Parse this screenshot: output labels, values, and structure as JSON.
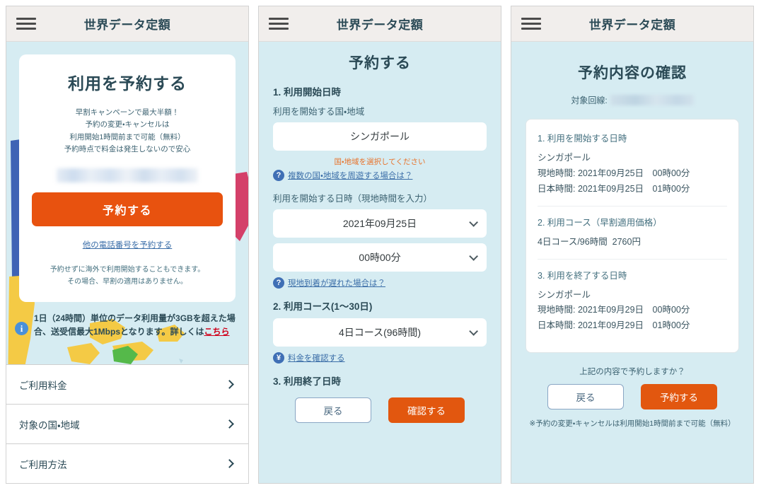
{
  "app": {
    "title": "世界データ定額",
    "menu_icon": "hamburger-icon",
    "colors": {
      "header_bg": "#f1eeec",
      "screen_bg": "#d6ecf2",
      "accent_orange": "#e8520f",
      "link_blue": "#3b6ea8",
      "title_navy": "#2b4a56",
      "error_orange": "#e8722a",
      "alert_red": "#d0021b"
    }
  },
  "screen1": {
    "hero": {
      "title": "利用を予約する",
      "subtitle_lines": [
        "早割キャンペーンで最大半額！",
        "予約の変更・キャンセルは",
        "利用開始1時間前まで可能（無料）",
        "予約時点で料金は発生しないので安心"
      ],
      "phone_number_masked": "",
      "reserve_button": "予約する",
      "other_number_link": "他の電話番号を予約する",
      "note_lines": [
        "予約せずに海外で利用開始することもできます。",
        "その場合、早割の適用はありません。"
      ]
    },
    "info": {
      "icon": "info-icon",
      "text_before": "1日（24時間）単位のデータ利用量が3GBを超えた場合、送受信最大1Mbpsとなります。詳しくは",
      "link": "こちら"
    },
    "list_items": [
      {
        "label": "ご利用料金",
        "chevron": "chevron-right-icon"
      },
      {
        "label": "対象の国・地域",
        "chevron": "chevron-right-icon"
      },
      {
        "label": "ご利用方法",
        "chevron": "chevron-right-icon"
      }
    ]
  },
  "screen2": {
    "page_title": "予約する",
    "section1_heading": "1. 利用開始日時",
    "country_label": "利用を開始する国・地域",
    "country_value": "シンガポール",
    "country_error": "国・地域を選択してください",
    "help_multi_country": "複数の国・地域を周遊する場合は？",
    "help_badge": "?",
    "datetime_label": "利用を開始する日時（現地時間を入力）",
    "date_value": "2021年09月25日",
    "time_value": "00時00分",
    "help_late_arrival": "現地到着が遅れた場合は？",
    "section2_heading": "2. 利用コース(1〜30日)",
    "course_value": "4日コース(96時間)",
    "help_check_fee": "料金を確認する",
    "fee_badge": "¥",
    "section3_heading": "3. 利用終了日時",
    "back_button": "戻る",
    "confirm_button": "確認する"
  },
  "screen3": {
    "page_title": "予約内容の確認",
    "line_label": "対象回線:",
    "line_value_masked": "",
    "blocks": [
      {
        "heading": "1. 利用を開始する日時",
        "lines": [
          "シンガポール",
          "現地時間: 2021年09月25日　00時00分",
          "日本時間: 2021年09月25日　01時00分"
        ]
      },
      {
        "heading": "2. 利用コース（早割適用価格）",
        "lines": [
          "4日コース/96時間  2760円"
        ]
      },
      {
        "heading": "3. 利用を終了する日時",
        "lines": [
          "シンガポール",
          "現地時間: 2021年09月29日　00時00分",
          "日本時間: 2021年09月29日　01時00分"
        ]
      }
    ],
    "ask": "上記の内容で予約しますか？",
    "back_button": "戻る",
    "reserve_button": "予約する",
    "footnote": "※予約の変更・キャンセルは利用開始1時間前まで可能（無料）"
  }
}
